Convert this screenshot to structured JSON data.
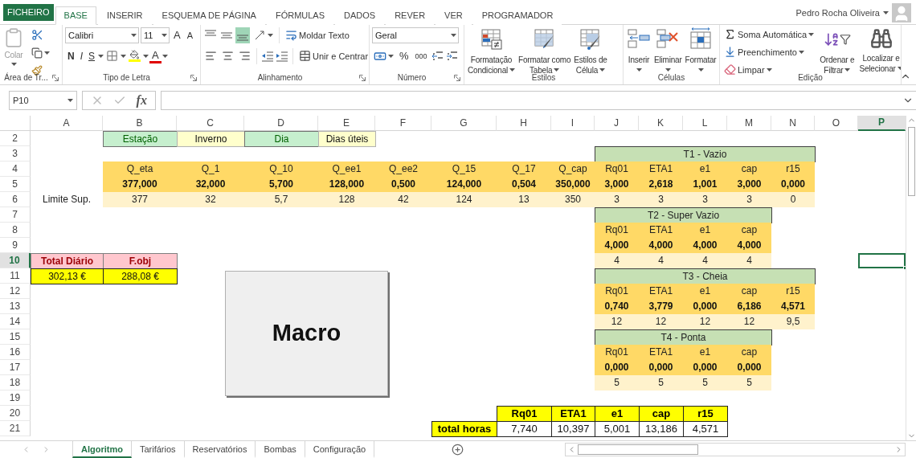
{
  "file_tab": "FICHEIRO",
  "tabs": [
    {
      "label": "BASE",
      "selected": true
    },
    {
      "label": "INSERIR",
      "selected": false
    },
    {
      "label": "ESQUEMA DE PÁGINA",
      "selected": false
    },
    {
      "label": "FÓRMULAS",
      "selected": false
    },
    {
      "label": "DADOS",
      "selected": false
    },
    {
      "label": "REVER",
      "selected": false
    },
    {
      "label": "VER",
      "selected": false
    },
    {
      "label": "PROGRAMADOR",
      "selected": false
    }
  ],
  "user": {
    "name": "Pedro Rocha Oliveira"
  },
  "clipboard": {
    "paste": "Colar",
    "label": "Área de Tr..."
  },
  "font": {
    "name": "Calibri",
    "size": "11",
    "grow": "A",
    "shrink": "A",
    "bold": "N",
    "italic": "I",
    "underline": "S",
    "color_glyph": "A",
    "label": "Tipo de Letra"
  },
  "alignment": {
    "vertical": [
      {
        "selected": false
      },
      {
        "selected": false
      },
      {
        "selected": true
      }
    ],
    "wrap": "Moldar Texto",
    "merge": "Unir e Centrar",
    "label": "Alinhamento"
  },
  "number": {
    "format": "Geral",
    "percent": "%",
    "thousands": "000",
    "label": "Número"
  },
  "styles": {
    "buttons": [
      {
        "kind": "conditional",
        "lines": [
          "Formatação",
          "Condicional"
        ]
      },
      {
        "kind": "table",
        "lines": [
          "Formatar como",
          "Tabela"
        ]
      },
      {
        "kind": "cellstyle",
        "lines": [
          "Estilos de",
          "Célula"
        ]
      }
    ],
    "label": "Estilos"
  },
  "cells_group": {
    "buttons": [
      {
        "kind": "insert",
        "lines": [
          "Inserir"
        ]
      },
      {
        "kind": "delete",
        "lines": [
          "Eliminar"
        ]
      },
      {
        "kind": "format",
        "lines": [
          "Formatar"
        ]
      }
    ],
    "label": "Células"
  },
  "editing": {
    "small": [
      {
        "kind": "sum",
        "label": "Soma Automática"
      },
      {
        "kind": "fill",
        "label": "Preenchimento"
      },
      {
        "kind": "clear",
        "label": "Limpar"
      }
    ],
    "buttons": [
      {
        "kind": "sort",
        "lines": [
          "Ordenar e",
          "Filtrar"
        ]
      },
      {
        "kind": "find",
        "lines": [
          "Localizar e",
          "Selecionar"
        ]
      }
    ],
    "label": "Edição"
  },
  "formula_bar": {
    "name_box": "P10",
    "function_symbol": "fx"
  },
  "columns": [
    {
      "label": "A",
      "selected": false
    },
    {
      "label": "B",
      "selected": false
    },
    {
      "label": "C",
      "selected": false
    },
    {
      "label": "D",
      "selected": false
    },
    {
      "label": "E",
      "selected": false
    },
    {
      "label": "F",
      "selected": false
    },
    {
      "label": "G",
      "selected": false
    },
    {
      "label": "H",
      "selected": false
    },
    {
      "label": "I",
      "selected": false
    },
    {
      "label": "J",
      "selected": false
    },
    {
      "label": "K",
      "selected": false
    },
    {
      "label": "L",
      "selected": false
    },
    {
      "label": "M",
      "selected": false
    },
    {
      "label": "N",
      "selected": false
    },
    {
      "label": "O",
      "selected": false
    },
    {
      "label": "P",
      "selected": true
    }
  ],
  "rows": [
    {
      "number": "2",
      "selected": false,
      "cells": {
        "B": {
          "text": "Estação",
          "kind": "good"
        },
        "C": {
          "text": "Inverno",
          "kind": "neutral"
        },
        "D": {
          "text": "Dia",
          "kind": "good"
        },
        "E": {
          "text": "Dias úteis",
          "kind": "neutral"
        }
      }
    },
    {
      "number": "3",
      "selected": false,
      "cells": {
        "J-N": {
          "text": "T1 - Vazio",
          "kind": "title"
        }
      }
    },
    {
      "number": "4",
      "selected": false,
      "cells": {
        "B": {
          "text": "Q_eta",
          "kind": "accent"
        },
        "C": {
          "text": "Q_1",
          "kind": "accent"
        },
        "D": {
          "text": "Q_10",
          "kind": "accent"
        },
        "E": {
          "text": "Q_ee1",
          "kind": "accent"
        },
        "F": {
          "text": "Q_ee2",
          "kind": "accent"
        },
        "G": {
          "text": "Q_15",
          "kind": "accent"
        },
        "H": {
          "text": "Q_17",
          "kind": "accent"
        },
        "I": {
          "text": "Q_cap",
          "kind": "accent"
        },
        "J": {
          "text": "Rq01",
          "kind": "accent"
        },
        "K": {
          "text": "ETA1",
          "kind": "accent"
        },
        "L": {
          "text": "e1",
          "kind": "accent"
        },
        "M": {
          "text": "cap",
          "kind": "accent"
        },
        "N": {
          "text": "r15",
          "kind": "accent"
        }
      }
    },
    {
      "number": "5",
      "selected": false,
      "cells": {
        "B": {
          "text": "377,000",
          "kind": "accent_bold"
        },
        "C": {
          "text": "32,000",
          "kind": "accent_bold"
        },
        "D": {
          "text": "5,700",
          "kind": "accent_bold"
        },
        "E": {
          "text": "128,000",
          "kind": "accent_bold"
        },
        "F": {
          "text": "0,500",
          "kind": "accent_bold"
        },
        "G": {
          "text": "124,000",
          "kind": "accent_bold"
        },
        "H": {
          "text": "0,504",
          "kind": "accent_bold"
        },
        "I": {
          "text": "350,000",
          "kind": "accent_bold"
        },
        "J": {
          "text": "3,000",
          "kind": "accent_bold"
        },
        "K": {
          "text": "2,618",
          "kind": "accent_bold"
        },
        "L": {
          "text": "1,001",
          "kind": "accent_bold"
        },
        "M": {
          "text": "3,000",
          "kind": "accent_bold"
        },
        "N": {
          "text": "0,000",
          "kind": "accent_bold"
        }
      }
    },
    {
      "number": "6",
      "selected": false,
      "cells": {
        "A": {
          "text": "Limite Sup.",
          "kind": "plain"
        },
        "B": {
          "text": "377",
          "kind": "light"
        },
        "C": {
          "text": "32",
          "kind": "light"
        },
        "D": {
          "text": "5,7",
          "kind": "light"
        },
        "E": {
          "text": "128",
          "kind": "light"
        },
        "F": {
          "text": "42",
          "kind": "light"
        },
        "G": {
          "text": "124",
          "kind": "light"
        },
        "H": {
          "text": "13",
          "kind": "light"
        },
        "I": {
          "text": "350",
          "kind": "light"
        },
        "J": {
          "text": "3",
          "kind": "light"
        },
        "K": {
          "text": "3",
          "kind": "light"
        },
        "L": {
          "text": "3",
          "kind": "light"
        },
        "M": {
          "text": "3",
          "kind": "light"
        },
        "N": {
          "text": "0",
          "kind": "light"
        }
      }
    },
    {
      "number": "7",
      "selected": false,
      "cells": {
        "J-M": {
          "text": "T2 - Super Vazio",
          "kind": "title"
        }
      }
    },
    {
      "number": "8",
      "selected": false,
      "cells": {
        "J": {
          "text": "Rq01",
          "kind": "accent"
        },
        "K": {
          "text": "ETA1",
          "kind": "accent"
        },
        "L": {
          "text": "e1",
          "kind": "accent"
        },
        "M": {
          "text": "cap",
          "kind": "accent"
        }
      }
    },
    {
      "number": "9",
      "selected": false,
      "cells": {
        "J": {
          "text": "4,000",
          "kind": "accent_bold"
        },
        "K": {
          "text": "4,000",
          "kind": "accent_bold"
        },
        "L": {
          "text": "4,000",
          "kind": "accent_bold"
        },
        "M": {
          "text": "4,000",
          "kind": "accent_bold"
        }
      }
    },
    {
      "number": "10",
      "selected": true,
      "cells": {
        "A": {
          "text": "Total Diário",
          "kind": "bad"
        },
        "B": {
          "text": "F.obj",
          "kind": "bad"
        },
        "J": {
          "text": "4",
          "kind": "light"
        },
        "K": {
          "text": "4",
          "kind": "light"
        },
        "L": {
          "text": "4",
          "kind": "light"
        },
        "M": {
          "text": "4",
          "kind": "light"
        }
      }
    },
    {
      "number": "11",
      "selected": false,
      "cells": {
        "A": {
          "text": "302,13 €",
          "kind": "yellow"
        },
        "B": {
          "text": "288,08 €",
          "kind": "yellow"
        },
        "J-N": {
          "text": "T3 - Cheia",
          "kind": "title"
        }
      }
    },
    {
      "number": "12",
      "selected": false,
      "cells": {
        "J": {
          "text": "Rq01",
          "kind": "accent"
        },
        "K": {
          "text": "ETA1",
          "kind": "accent"
        },
        "L": {
          "text": "e1",
          "kind": "accent"
        },
        "M": {
          "text": "cap",
          "kind": "accent"
        },
        "N": {
          "text": "r15",
          "kind": "accent"
        }
      }
    },
    {
      "number": "13",
      "selected": false,
      "cells": {
        "J": {
          "text": "0,740",
          "kind": "accent_bold"
        },
        "K": {
          "text": "3,779",
          "kind": "accent_bold"
        },
        "L": {
          "text": "0,000",
          "kind": "accent_bold"
        },
        "M": {
          "text": "6,186",
          "kind": "accent_bold"
        },
        "N": {
          "text": "4,571",
          "kind": "accent_bold"
        }
      }
    },
    {
      "number": "14",
      "selected": false,
      "cells": {
        "J": {
          "text": "12",
          "kind": "light"
        },
        "K": {
          "text": "12",
          "kind": "light"
        },
        "L": {
          "text": "12",
          "kind": "light"
        },
        "M": {
          "text": "12",
          "kind": "light"
        },
        "N": {
          "text": "9,5",
          "kind": "light"
        }
      }
    },
    {
      "number": "15",
      "selected": false,
      "cells": {
        "J-M": {
          "text": "T4 - Ponta",
          "kind": "title"
        }
      }
    },
    {
      "number": "16",
      "selected": false,
      "cells": {
        "J": {
          "text": "Rq01",
          "kind": "accent"
        },
        "K": {
          "text": "ETA1",
          "kind": "accent"
        },
        "L": {
          "text": "e1",
          "kind": "accent"
        },
        "M": {
          "text": "cap",
          "kind": "accent"
        }
      }
    },
    {
      "number": "17",
      "selected": false,
      "cells": {
        "J": {
          "text": "0,000",
          "kind": "accent_bold"
        },
        "K": {
          "text": "0,000",
          "kind": "accent_bold"
        },
        "L": {
          "text": "0,000",
          "kind": "accent_bold"
        },
        "M": {
          "text": "0,000",
          "kind": "accent_bold"
        }
      }
    },
    {
      "number": "18",
      "selected": false,
      "cells": {
        "J": {
          "text": "5",
          "kind": "light"
        },
        "K": {
          "text": "5",
          "kind": "light"
        },
        "L": {
          "text": "5",
          "kind": "light"
        },
        "M": {
          "text": "5",
          "kind": "light"
        }
      }
    },
    {
      "number": "19",
      "selected": false
    },
    {
      "number": "20",
      "selected": false,
      "cells": {
        "H": {
          "text": "Rq01",
          "kind": "highlight"
        },
        "I": {
          "text": "ETA1",
          "kind": "highlight"
        },
        "J": {
          "text": "e1",
          "kind": "highlight"
        },
        "K": {
          "text": "cap",
          "kind": "highlight"
        },
        "L": {
          "text": "r15",
          "kind": "highlight"
        }
      }
    },
    {
      "number": "21",
      "selected": false,
      "cells": {
        "G": {
          "text": "total horas",
          "kind": "highlight"
        },
        "H": {
          "text": "7,740",
          "kind": "boxed"
        },
        "I": {
          "text": "10,397",
          "kind": "boxed"
        },
        "J": {
          "text": "5,001",
          "kind": "boxed"
        },
        "K": {
          "text": "13,186",
          "kind": "boxed"
        },
        "L": {
          "text": "4,571",
          "kind": "boxed"
        }
      }
    }
  ],
  "macro_button": {
    "label": "Macro"
  },
  "sheet_tabs": [
    {
      "label": "Algoritmo",
      "selected": true
    },
    {
      "label": "Tarifários",
      "selected": false
    },
    {
      "label": "Reservatórios",
      "selected": false
    },
    {
      "label": "Bombas",
      "selected": false
    },
    {
      "label": "Configuração",
      "selected": false
    }
  ]
}
